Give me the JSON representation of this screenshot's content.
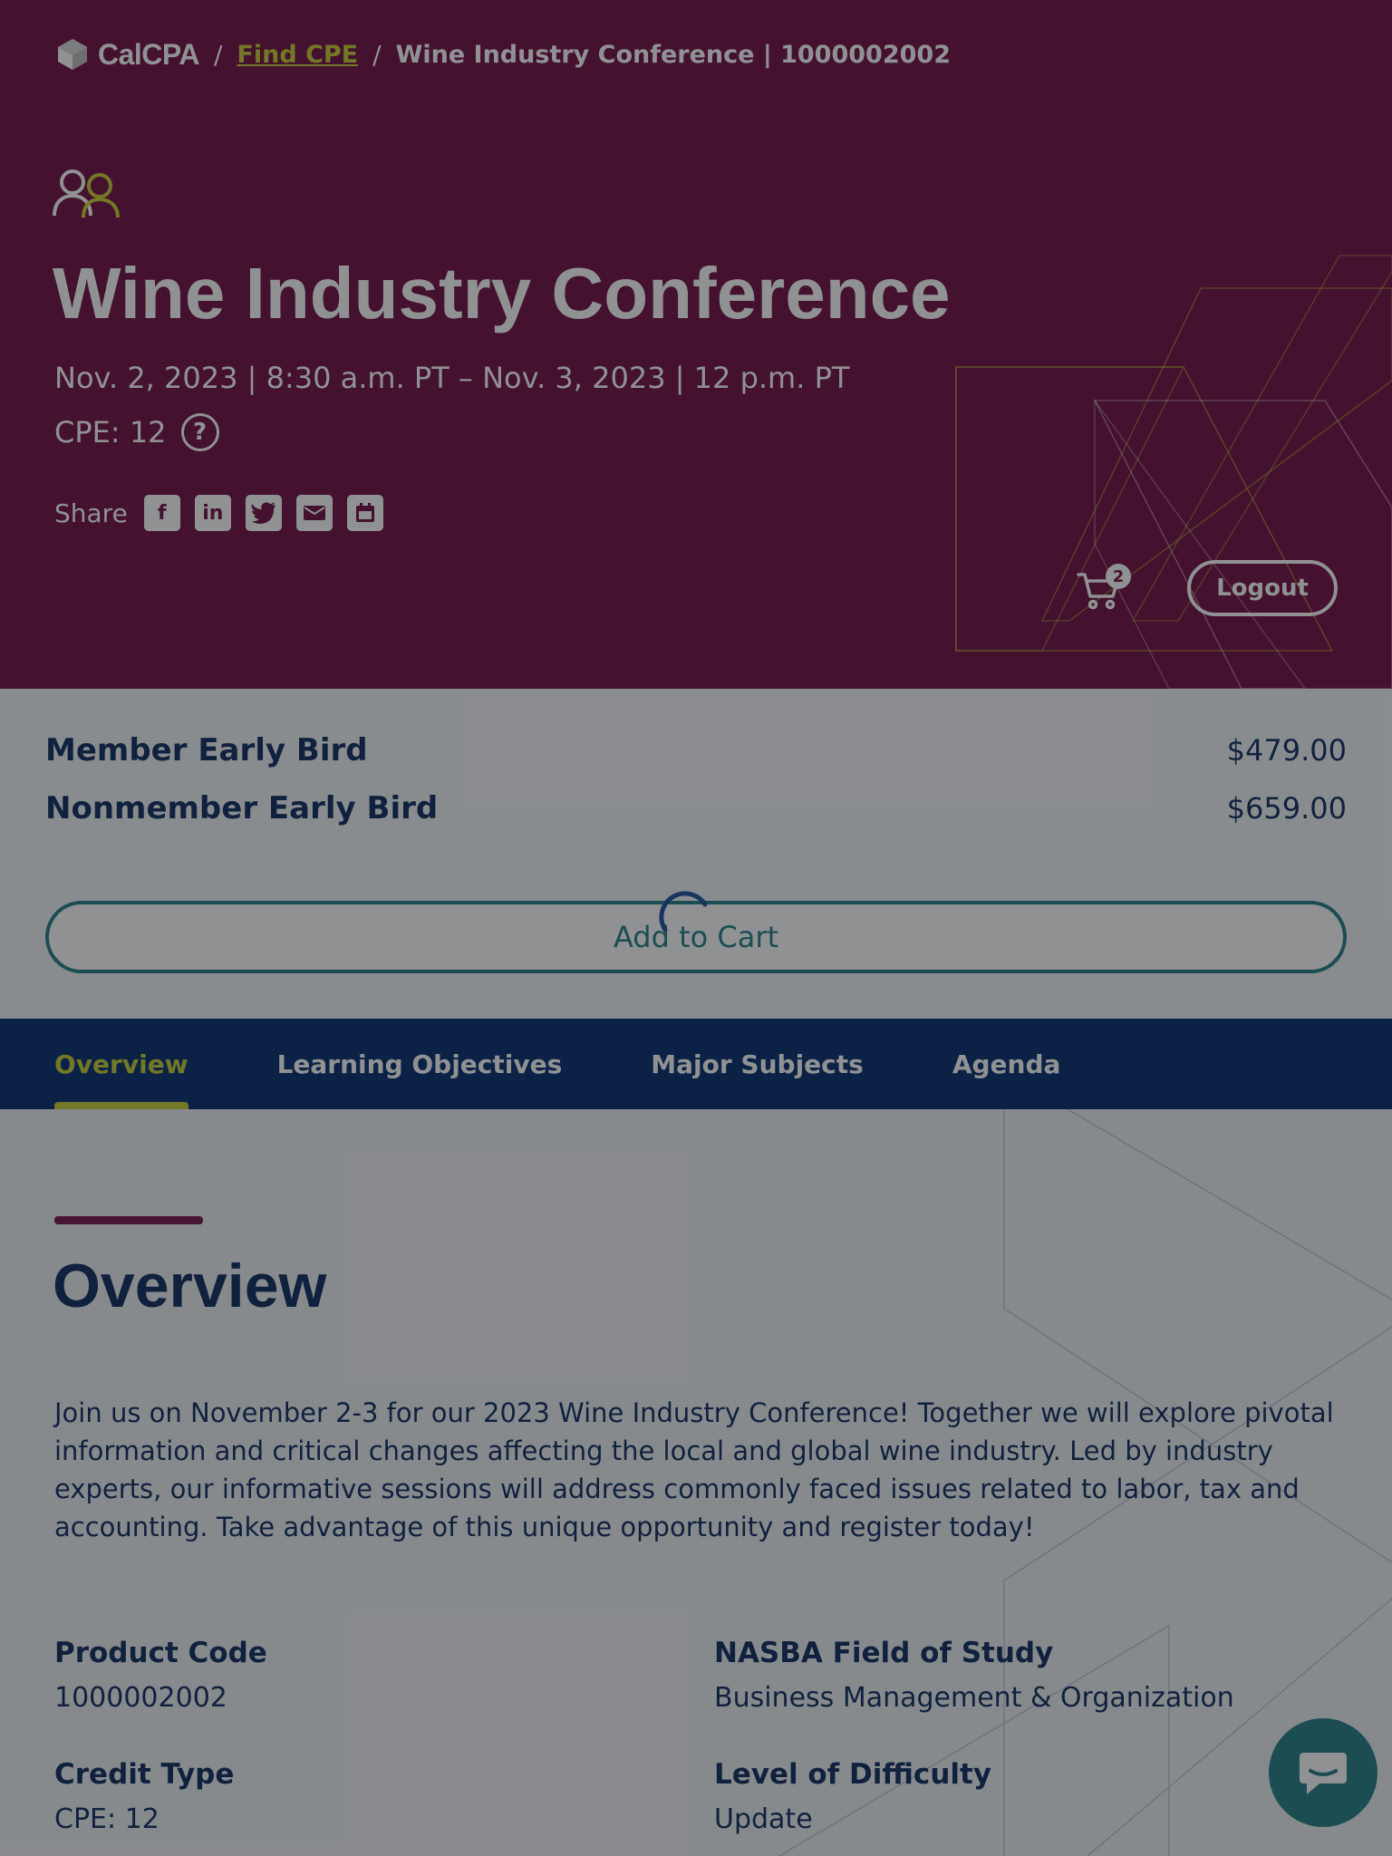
{
  "breadcrumb": {
    "logo": "CalCPA",
    "separator": "/",
    "link": "Find CPE",
    "current": "Wine Industry Conference | 1000002002"
  },
  "hero": {
    "icon": "people-icon",
    "title": "Wine Industry Conference",
    "date": "Nov. 2, 2023 | 8:30 a.m. PT – Nov. 3, 2023 | 12 p.m. PT",
    "cpe": "CPE: 12",
    "help_icon": "question-circle-icon",
    "share_label": "Share",
    "share_icons": [
      "facebook-icon",
      "linkedin-icon",
      "twitter-icon",
      "email-icon",
      "calendar-icon"
    ],
    "cart_count": "2",
    "logout_label": "Logout"
  },
  "pricing": {
    "rows": [
      {
        "name": "Member Early Bird",
        "price": "$479.00"
      },
      {
        "name": "Nonmember Early Bird",
        "price": "$659.00"
      }
    ],
    "add_to_cart_label": "Add to Cart"
  },
  "tabs": [
    {
      "label": "Overview",
      "active": true
    },
    {
      "label": "Learning Objectives",
      "active": false
    },
    {
      "label": "Major Subjects",
      "active": false
    },
    {
      "label": "Agenda",
      "active": false
    }
  ],
  "overview": {
    "heading": "Overview",
    "intro": "Join us on November 2-3 for our 2023 Wine Industry Conference! Together we will explore pivotal information and critical changes affecting the local and global wine industry. Led by industry experts, our informative sessions will address commonly faced issues related to labor, tax and accounting. Take advantage of this unique opportunity and register today!",
    "fields": [
      {
        "label": "Product Code",
        "value": "1000002002"
      },
      {
        "label": "NASBA Field of Study",
        "value": "Business Management & Organization"
      },
      {
        "label": "Credit Type",
        "value": "CPE: 12"
      },
      {
        "label": "Level of Difficulty",
        "value": "Update"
      }
    ]
  },
  "colors": {
    "hero_bg": "#6e0a3f",
    "accent_lime": "#c7cf2e",
    "navy": "#0b2a5c",
    "tab_bar": "#002b6b",
    "teal": "#1f7d85"
  }
}
